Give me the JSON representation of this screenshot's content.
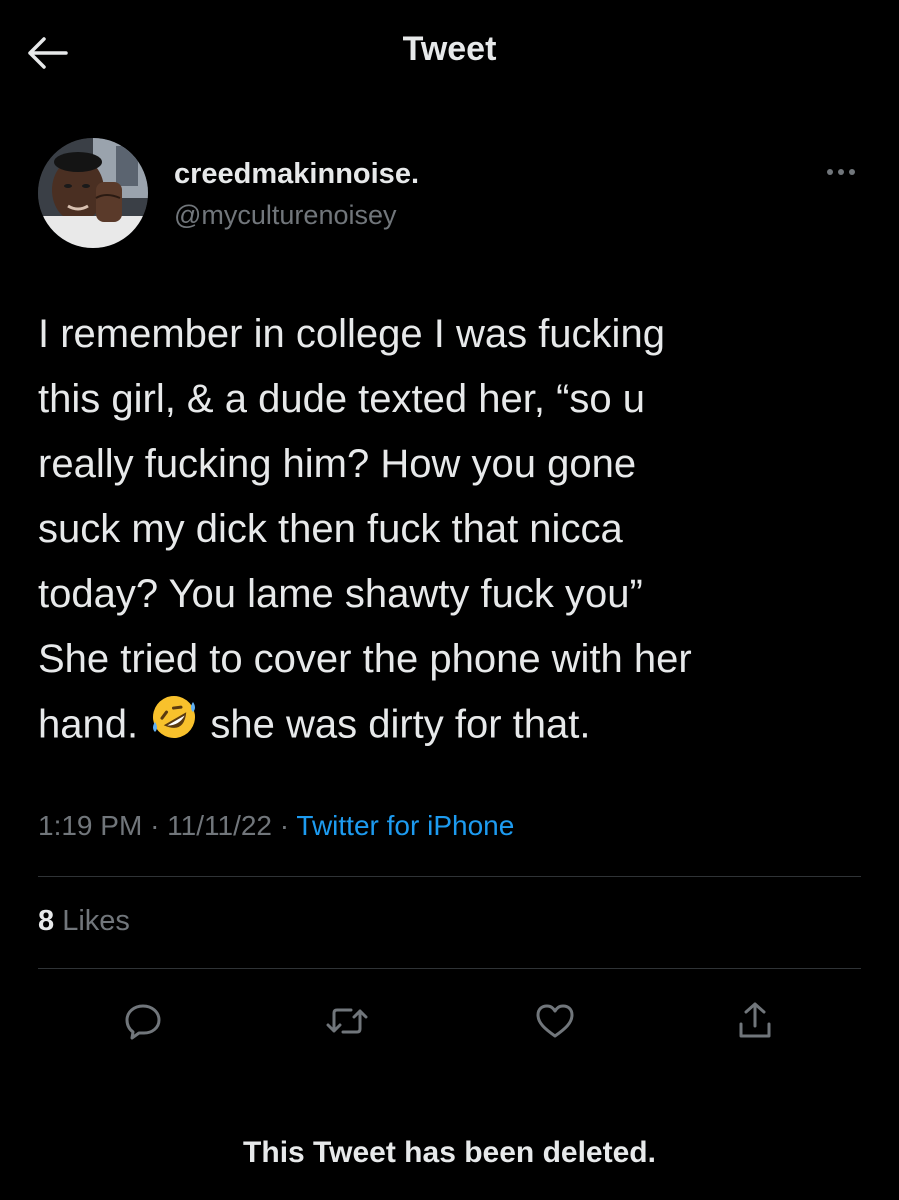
{
  "header": {
    "title": "Tweet",
    "back_icon": "arrow-left-icon"
  },
  "author": {
    "display_name": "creedmakinnoise.",
    "handle": "@myculturenoisey",
    "more_icon": "more-horizontal-icon"
  },
  "tweet": {
    "lines": [
      "I remember in college I was fucking",
      "this girl, & a dude texted her, “so u",
      "really fucking him? How you gone",
      "suck my dick then fuck that nicca",
      "today? You lame shawty fuck you”",
      "She tried to cover the phone with her"
    ],
    "last_line_before_emoji": "hand.",
    "emoji": "rolling-on-floor-laughing-emoji",
    "last_line_after_emoji": "she was dirty for that."
  },
  "meta": {
    "time": "1:19 PM",
    "separator": "·",
    "date": "11/11/22",
    "source": "Twitter for iPhone"
  },
  "stats": {
    "likes_count": "8",
    "likes_label": "Likes"
  },
  "actions": [
    {
      "name": "reply",
      "icon": "reply-icon"
    },
    {
      "name": "retweet",
      "icon": "retweet-icon"
    },
    {
      "name": "like",
      "icon": "heart-icon"
    },
    {
      "name": "share",
      "icon": "share-icon"
    }
  ],
  "footer": {
    "deleted_notice": "This Tweet has been deleted."
  },
  "colors": {
    "background": "#000000",
    "text": "#e7e9ea",
    "secondary": "#71767b",
    "link": "#1d9bf0",
    "divider": "#2f3336"
  }
}
